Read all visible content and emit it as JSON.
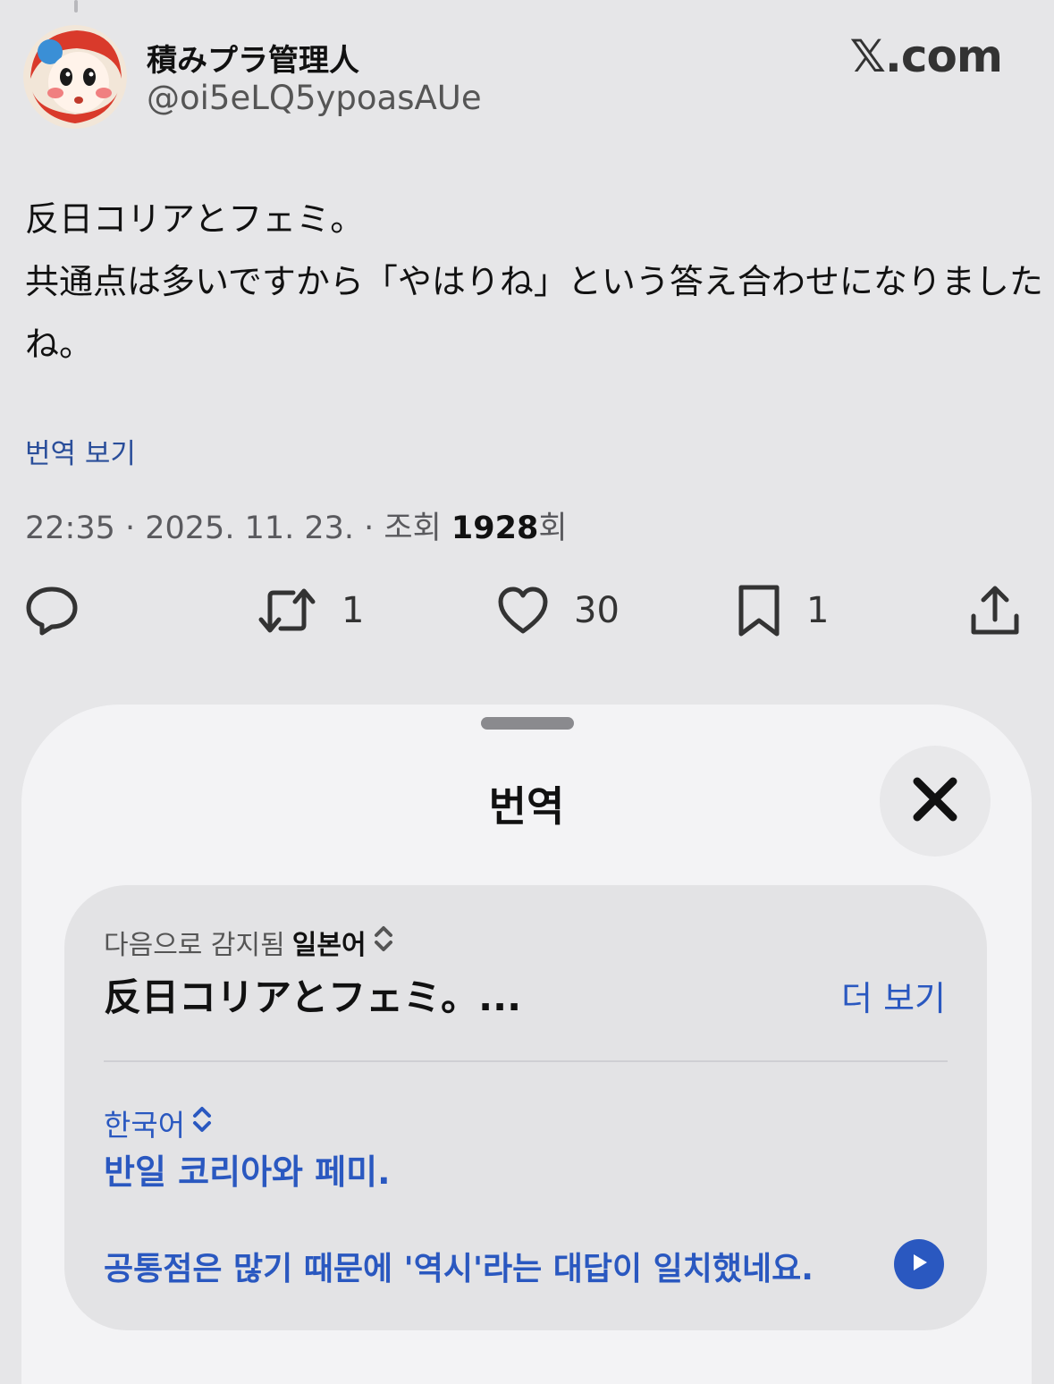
{
  "tweet": {
    "author": {
      "display_name": "積みプラ管理人",
      "handle": "@oi5eLQ5ypoasAUe"
    },
    "source": "𝕏.com",
    "text_lines": [
      "反日コリアとフェミ。",
      "共通点は多いですから「やはりね」という答え合わせになりました",
      "ね。"
    ],
    "translate_link": "번역 보기",
    "meta": {
      "time_date": "22:35 · 2025. 11. 23. · 조회 ",
      "views": "1928",
      "views_suffix": "회"
    },
    "actions": {
      "reply": {
        "icon": "reply-icon"
      },
      "retweet": {
        "icon": "retweet-icon",
        "count": "1"
      },
      "like": {
        "icon": "heart-icon",
        "count": "30"
      },
      "bookmark": {
        "icon": "bookmark-icon",
        "count": "1"
      },
      "share": {
        "icon": "share-icon"
      }
    }
  },
  "translation_sheet": {
    "title": "번역",
    "close_icon": "close-icon",
    "detected_prefix": "다음으로 감지됨 ",
    "source_language": "일본어",
    "source_text": "反日コリアとフェミ。...",
    "more_label": "더 보기",
    "target_language": "한국어",
    "translation_line1": "반일 코리아와 페미.",
    "translation_line2": "공통점은 많기 때문에 '역시'라는 대답이 일치했네요.",
    "play_icon": "play-icon"
  },
  "colors": {
    "background": "#e6e6e8",
    "sheet": "#f3f3f5",
    "card": "#e3e3e5",
    "accent_blue": "#2a58c0",
    "link_blue": "#2a4e9a"
  }
}
